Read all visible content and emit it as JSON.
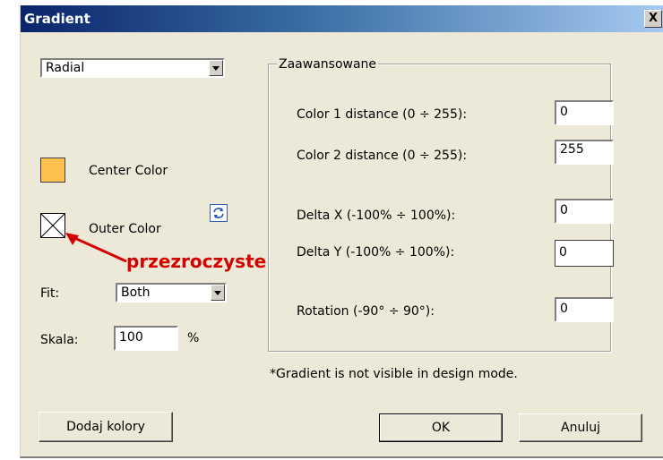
{
  "window": {
    "title": "Gradient",
    "close_glyph": "X"
  },
  "left": {
    "type_combo": {
      "value": "Radial"
    },
    "center_color": {
      "label": "Center Color",
      "swatch": "#ffc050"
    },
    "outer_color": {
      "label": "Outer Color",
      "swatch": "transparent"
    },
    "swap_icon": "swap-colors-icon",
    "annotation": {
      "text": "przezroczyste",
      "color": "#d40000"
    },
    "fit": {
      "label": "Fit:",
      "value": "Both"
    },
    "scale": {
      "label": "Skala:",
      "value": "100",
      "unit": "%"
    }
  },
  "advanced": {
    "group_label": "Zaawansowane",
    "fields": [
      {
        "label": "Color 1 distance (0 ÷ 255):",
        "value": "0"
      },
      {
        "label": "Color 2 distance (0 ÷ 255):",
        "value": "255"
      },
      {
        "label": "Delta X (-100% ÷ 100%):",
        "value": "0"
      },
      {
        "label": "Delta Y (-100% ÷ 100%):",
        "value": "0"
      },
      {
        "label": "Rotation (-90° ÷ 90°):",
        "value": "0"
      }
    ]
  },
  "note": "*Gradient is not visible in design mode.",
  "buttons": {
    "add_colors": "Dodaj kolory",
    "ok": "OK",
    "cancel": "Anuluj"
  }
}
